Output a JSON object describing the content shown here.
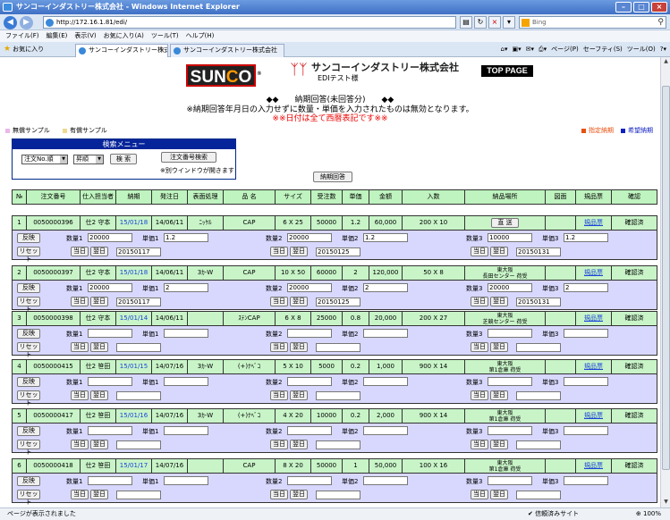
{
  "window": {
    "title": "サンコーインダストリー株式会社 - Windows Internet Explorer"
  },
  "address": {
    "url": "http://172.16.1.81/edi/",
    "search_placeholder": "Bing"
  },
  "menu": [
    "ファイル(F)",
    "編集(E)",
    "表示(V)",
    "お気に入り(A)",
    "ツール(T)",
    "ヘルプ(H)"
  ],
  "favorites_label": "お気に入り",
  "tabs": [
    {
      "label": "サンコーインダストリー株式..."
    },
    {
      "label": "サンコーインダストリー株式会社"
    }
  ],
  "tools": [
    "ページ(P)",
    "セーフティ(S)",
    "ツール(O)"
  ],
  "status": {
    "left": "ページが表示されました",
    "zone": "信頼済みサイト",
    "zoom": "100%"
  },
  "header": {
    "logo_text": "SUNCO",
    "company": "サンコーインダストリー株式会社",
    "user": "EDIテスト様",
    "top_page": "TOP PAGE"
  },
  "page": {
    "title": "◆◆　　納期回答(未回答分)　　◆◆",
    "note": "※納期回答年月日の入力せずに数量・単価を入力されたものは無効となります。",
    "note2": "※※日付は全て西暦表記です※※"
  },
  "legend": {
    "unpaid": "無償サンプル",
    "paid": "有償サンプル",
    "specified": "指定納期",
    "desired": "希望納期",
    "colors": {
      "unpaid": "#e8b8e8",
      "paid": "#f0d890",
      "specified": "#e85010",
      "desired": "#1020c0"
    }
  },
  "search_menu": {
    "title": "検索メニュー",
    "sort1": "注文No.順",
    "sort2": "昇順",
    "search_btn": "検 索",
    "order_search_btn": "注文番号検索",
    "note": "※別ウインドウが開きます"
  },
  "reply_button": "納期回答",
  "columns": [
    "№",
    "注文番号",
    "仕入担当者",
    "納期",
    "発注日",
    "表面処理",
    "品 名",
    "サイズ",
    "受注数",
    "単価",
    "金額",
    "入数",
    "納品場所",
    "図面",
    "規品票",
    "確認"
  ],
  "labels": {
    "reflect": "反映",
    "reset": "リセット",
    "qty1": "数量1",
    "qty2": "数量2",
    "qty3": "数量3",
    "price1": "単価1",
    "price2": "単価2",
    "price3": "単価3",
    "today": "当日",
    "next": "翌日",
    "direct": "直 送"
  },
  "rows": [
    {
      "no": "1",
      "order": "0050000396",
      "buyer": "仕2 守本",
      "due": "15/01/18",
      "ordered": "14/06/11",
      "surface": "ﾆｯｹﾙ",
      "product": "CAP",
      "size": "6 X 25",
      "qty": "50000",
      "price": "1.2",
      "amount": "60,000",
      "pack": "200 X 10",
      "place1": "",
      "place2": "",
      "direct": true,
      "spec": "規品票",
      "confirm": "確認済",
      "q1": "20000",
      "p1": "1.2",
      "d1": "20150117",
      "q2": "20000",
      "p2": "1.2",
      "d2": "20150125",
      "q3": "10000",
      "p3": "1.2",
      "d3": "20150131"
    },
    {
      "no": "2",
      "order": "0050000397",
      "buyer": "仕2 守本",
      "due": "15/01/18",
      "ordered": "14/06/11",
      "surface": "3ｶ-W",
      "product": "CAP",
      "size": "10 X 50",
      "qty": "60000",
      "price": "2",
      "amount": "120,000",
      "pack": "50 X 8",
      "place1": "東大阪",
      "place2": "長田センター 荷受",
      "direct": false,
      "spec": "規品票",
      "confirm": "確認済",
      "q1": "20000",
      "p1": "2",
      "d1": "20150117",
      "q2": "20000",
      "p2": "2",
      "d2": "20150125",
      "q3": "20000",
      "p3": "2",
      "d3": "20150131"
    },
    {
      "no": "3",
      "order": "0050000398",
      "buyer": "仕2 守本",
      "due": "15/01/14",
      "ordered": "14/06/11",
      "surface": "",
      "product": "ｽﾃﾝCAP",
      "size": "6 X 8",
      "qty": "25000",
      "price": "0.8",
      "amount": "20,000",
      "pack": "200 X 27",
      "place1": "東大阪",
      "place2": "芝競センター 荷受",
      "direct": false,
      "spec": "規品票",
      "confirm": "確認済",
      "q1": "",
      "p1": "",
      "d1": "",
      "q2": "",
      "p2": "",
      "d2": "",
      "q3": "",
      "p3": "",
      "d3": ""
    },
    {
      "no": "4",
      "order": "0050000415",
      "buyer": "仕2 笹田",
      "due": "15/01/15",
      "ordered": "14/07/16",
      "surface": "3ｶ-W",
      "product": "(+)ﾅﾍﾞｺ",
      "size": "5 X 10",
      "qty": "5000",
      "price": "0.2",
      "amount": "1,000",
      "pack": "900 X 14",
      "place1": "東大阪",
      "place2": "第1倉庫 荷受",
      "direct": false,
      "spec": "規品票",
      "confirm": "確認済",
      "q1": "",
      "p1": "",
      "d1": "",
      "q2": "",
      "p2": "",
      "d2": "",
      "q3": "",
      "p3": "",
      "d3": ""
    },
    {
      "no": "5",
      "order": "0050000417",
      "buyer": "仕2 笹田",
      "due": "15/01/16",
      "ordered": "14/07/16",
      "surface": "3ｶ-W",
      "product": "(+)ﾅﾍﾞｺ",
      "size": "4 X 20",
      "qty": "10000",
      "price": "0.2",
      "amount": "2,000",
      "pack": "900 X 14",
      "place1": "東大阪",
      "place2": "第1倉庫 荷受",
      "direct": false,
      "spec": "規品票",
      "confirm": "確認済",
      "q1": "",
      "p1": "",
      "d1": "",
      "q2": "",
      "p2": "",
      "d2": "",
      "q3": "",
      "p3": "",
      "d3": ""
    },
    {
      "no": "6",
      "order": "0050000418",
      "buyer": "仕2 笹田",
      "due": "15/01/17",
      "ordered": "14/07/16",
      "surface": "",
      "product": "CAP",
      "size": "8 X 20",
      "qty": "50000",
      "price": "1",
      "amount": "50,000",
      "pack": "100 X 16",
      "place1": "東大阪",
      "place2": "第1倉庫 荷受",
      "direct": false,
      "spec": "規品票",
      "confirm": "確認済",
      "q1": "",
      "p1": "",
      "d1": "",
      "q2": "",
      "p2": "",
      "d2": "",
      "q3": "",
      "p3": "",
      "d3": ""
    }
  ]
}
